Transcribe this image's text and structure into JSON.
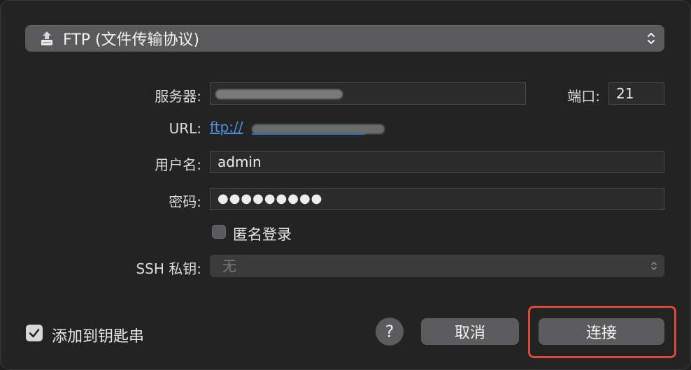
{
  "protocol": {
    "selected": "FTP (文件传输协议)",
    "icon": "ftp-drive-icon"
  },
  "server": {
    "label": "服务器:",
    "value": ""
  },
  "port": {
    "label": "端口:",
    "value": "21"
  },
  "url": {
    "label": "URL:",
    "value": "ftp://"
  },
  "username": {
    "label": "用户名:",
    "value": "admin"
  },
  "password": {
    "label": "密码:",
    "value": "●●●●●●●●●"
  },
  "anonymous": {
    "label": "匿名登录",
    "checked": false
  },
  "ssh_key": {
    "label": "SSH 私钥:",
    "value": "无"
  },
  "keychain": {
    "label": "添加到钥匙串",
    "checked": true
  },
  "buttons": {
    "help": "?",
    "cancel": "取消",
    "connect": "连接"
  },
  "colors": {
    "highlight": "#d94a36",
    "link": "#4a90e2"
  }
}
